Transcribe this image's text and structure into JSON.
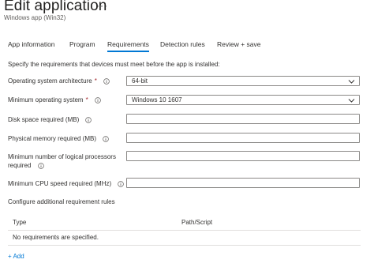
{
  "header": {
    "title": "Edit application",
    "more_label": "···",
    "subtitle": "Windows app (Win32)"
  },
  "tabs": [
    {
      "label": "App information",
      "active": false
    },
    {
      "label": "Program",
      "active": false
    },
    {
      "label": "Requirements",
      "active": true
    },
    {
      "label": "Detection rules",
      "active": false
    },
    {
      "label": "Review + save",
      "active": false
    }
  ],
  "intro": "Specify the requirements that devices must meet before the app is installed:",
  "form": {
    "os_architecture": {
      "label": "Operating system architecture",
      "required_mark": "*",
      "value": "64-bit"
    },
    "min_os": {
      "label": "Minimum operating system",
      "required_mark": "*",
      "value": "Windows 10 1607"
    },
    "disk_space": {
      "label": "Disk space required (MB)",
      "value": ""
    },
    "physical_memory": {
      "label": "Physical memory required (MB)",
      "value": ""
    },
    "logical_processors": {
      "label_line1": "Minimum number of logical processors",
      "label_line2": "required",
      "value": ""
    },
    "cpu_speed": {
      "label": "Minimum CPU speed required (MHz)",
      "value": ""
    }
  },
  "additional_rules": {
    "heading": "Configure additional requirement rules",
    "columns": [
      "Type",
      "Path/Script"
    ],
    "empty_message": "No requirements are specified.",
    "add_label": "+ Add"
  },
  "colors": {
    "accent": "#0078d4",
    "required": "#a4262c",
    "border": "#8a8886",
    "divider": "#e1dfdd"
  },
  "icons": {
    "info": "info-icon",
    "dropdown": "chevron-down-icon"
  }
}
